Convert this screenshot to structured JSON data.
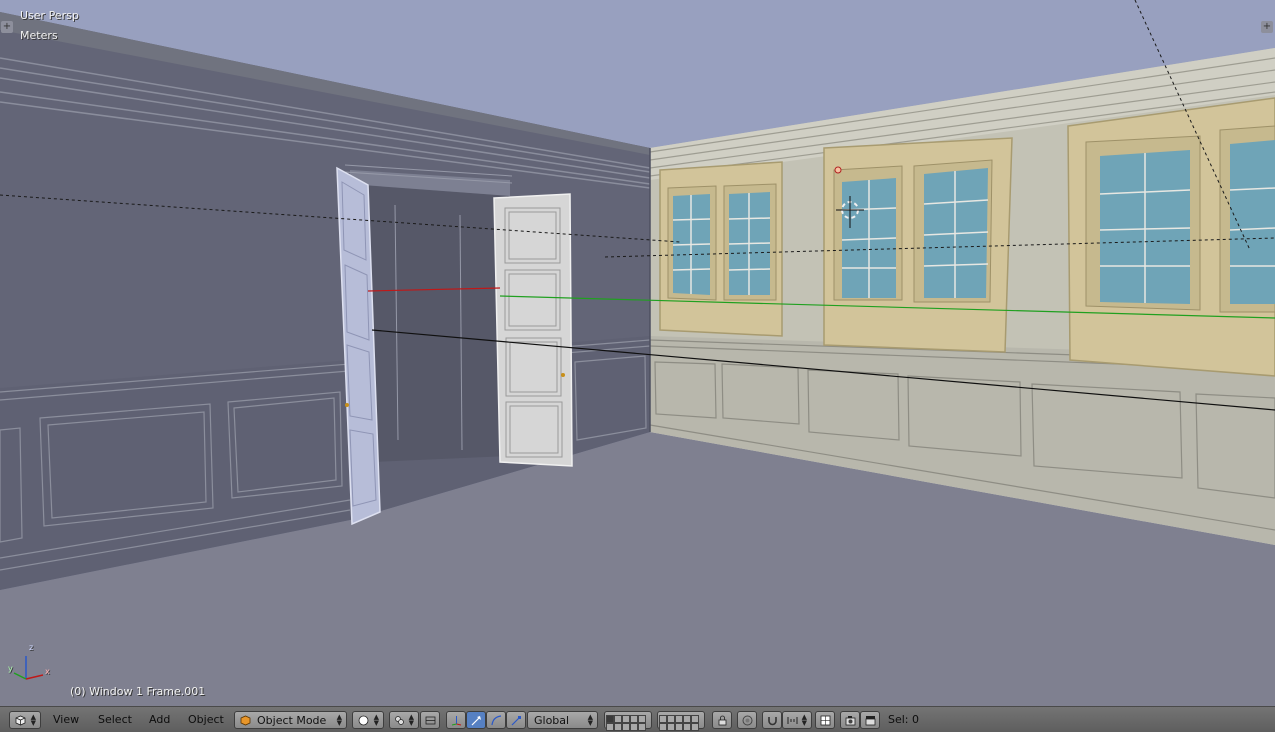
{
  "viewport": {
    "view_name": "User Persp",
    "units": "Meters",
    "frame_info": "(0) Window 1 Frame.001",
    "axes": {
      "x": "x",
      "y": "y",
      "z": "z"
    },
    "colors": {
      "sky": "#98a0bf",
      "floor": "#7f8090",
      "x_axis": "#c01818",
      "y_axis": "#20a020"
    }
  },
  "toolbar": {
    "editor_type_icon": "cube-icon",
    "menus": {
      "view": "View",
      "select": "Select",
      "add": "Add",
      "object": "Object"
    },
    "mode": "Object Mode",
    "orientation": "Global",
    "selection_status": "Sel: 0"
  }
}
